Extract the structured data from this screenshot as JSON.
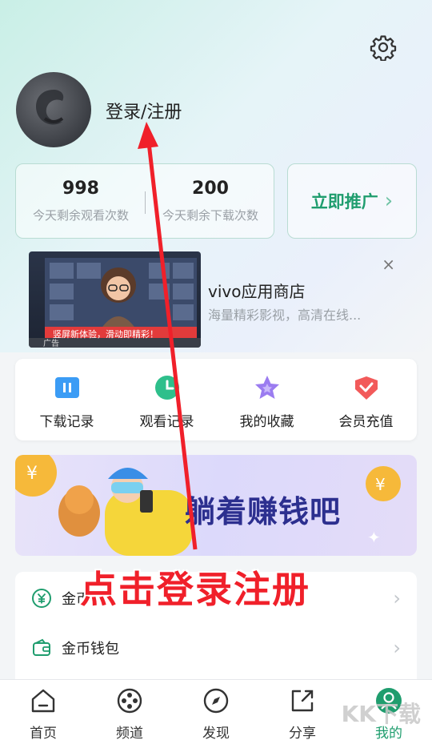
{
  "header": {
    "login_label": "登录/注册"
  },
  "stats": [
    {
      "value": "998",
      "label": "今天剩余观看次数"
    },
    {
      "value": "200",
      "label": "今天剩余下载次数"
    }
  ],
  "promote": {
    "label": "立即推广",
    "chevron": "›"
  },
  "ad": {
    "title": "vivo应用商店",
    "description": "海量精彩影视，高清在线...",
    "close": "×",
    "image_caption": "竖屏新体验，滑动即精彩！",
    "ad_tag": "广告"
  },
  "quick_actions": [
    {
      "label": "下载记录",
      "icon": "download-icon",
      "color": "#3b9cf5"
    },
    {
      "label": "观看记录",
      "icon": "clock-icon",
      "color": "#2ebf8b"
    },
    {
      "label": "我的收藏",
      "icon": "star-icon",
      "color": "#9b7cf0"
    },
    {
      "label": "会员充值",
      "icon": "diamond-icon",
      "color": "#f25a5a"
    }
  ],
  "banner": {
    "text": "躺着赚钱吧"
  },
  "menu": [
    {
      "label": "金币",
      "icon": "yen-coin-icon"
    },
    {
      "label": "金币钱包",
      "icon": "wallet-icon"
    }
  ],
  "overlay_caption": "点击登录注册",
  "tabs": [
    {
      "label": "首页",
      "icon": "home-icon",
      "active": false
    },
    {
      "label": "频道",
      "icon": "film-reel-icon",
      "active": false
    },
    {
      "label": "发现",
      "icon": "compass-icon",
      "active": false
    },
    {
      "label": "分享",
      "icon": "share-icon",
      "active": false
    },
    {
      "label": "我的",
      "icon": "profile-icon",
      "active": true
    }
  ],
  "watermark": "KK下载",
  "colors": {
    "accent": "#1f9d6e",
    "annotation": "#f0202a"
  }
}
